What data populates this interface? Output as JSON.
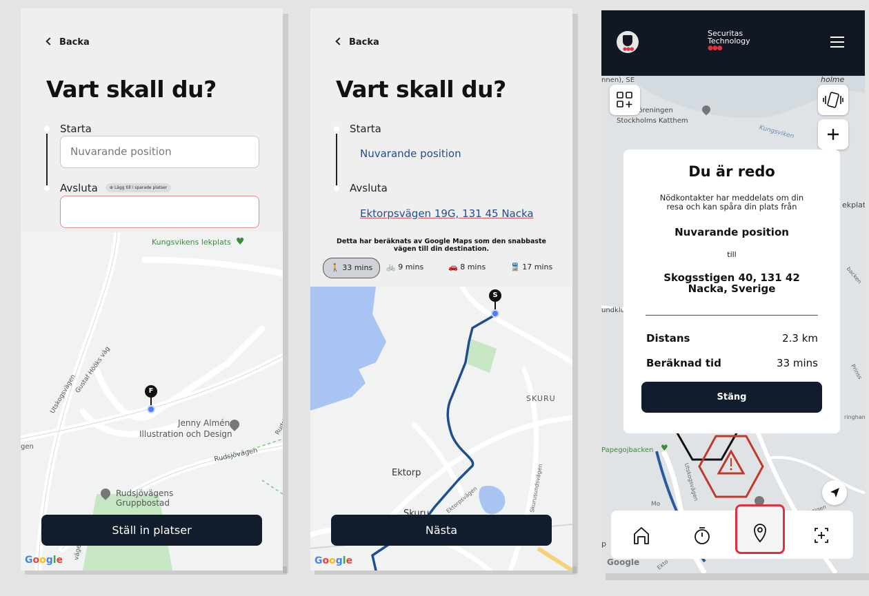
{
  "screen1": {
    "back": "Backa",
    "heading": "Vart skall du?",
    "start_label": "Starta",
    "start_placeholder": "Nuvarande position",
    "end_label": "Avsluta",
    "saved_chip": "Lägg till i sparade platser",
    "end_value": "",
    "map_labels": {
      "kungsvikens": "Kungsvikens lekplats",
      "utskogsvagen": "Utskogsvägen",
      "gustaf": "Gustaf Hööks väg",
      "jenny1": "Jenny Almén",
      "jenny2": "Illustration och Design",
      "rudsjo": "Rudsjövägen",
      "rudsjogrp1": "Rudsjövägens",
      "rudsjogrp2": "Gruppbostad",
      "gen": "gen",
      "rudsj": "Rudsj",
      "vage": "väge"
    },
    "pin_letter": "F",
    "button": "Ställ in platser",
    "google": "Google"
  },
  "screen2": {
    "back": "Backa",
    "heading": "Vart skall du?",
    "start_label": "Starta",
    "start_value": "Nuvarande position",
    "end_label": "Avsluta",
    "end_value": "Ektorpsvägen 19G, 131 45 Nacka",
    "info": "Detta har beräknats av Google Maps som den snabbaste vägen till din destination.",
    "modes": [
      {
        "icon": "walk-icon",
        "label": "33 mins",
        "selected": true
      },
      {
        "icon": "bike-icon",
        "label": "9 mins",
        "selected": false
      },
      {
        "icon": "car-icon",
        "label": "8 mins",
        "selected": false
      },
      {
        "icon": "transit-icon",
        "label": "17 mins",
        "selected": false
      }
    ],
    "map_labels": {
      "skuru": "SKURU",
      "ektorp": "Ektorp",
      "skuru2": "Skuru",
      "ektorpsvagen": "Ektorpsvägen",
      "skurusund": "Skurusundsvägen"
    },
    "pin_letter": "S",
    "button": "Nästa",
    "google": "Google"
  },
  "screen3": {
    "brand_line1": "Securitas",
    "brand_line2": "Technology",
    "map_labels": {
      "se": "nnen), SE",
      "holme": "holme",
      "foreningen1": "Föreningen",
      "foreningen2": "Stockholms Katthem",
      "kungsviken": "Kungsviken",
      "ekplat": "ekplat",
      "undklu": "undklu",
      "papegoj": "Papegojbacken",
      "solst": "Solstigen",
      "backen": "backen",
      "ringham": "ringham",
      "prinss": "Prinss",
      "utskogsv": "Utskogsvägen",
      "mo": "Mo",
      "p": "p",
      "oogle": "Google",
      "ekto": "Ekto"
    },
    "card": {
      "title": "Du är redo",
      "subtitle": "Nödkontakter har meddelats om din resa och kan spåra din plats från",
      "from": "Nuvarande position",
      "till": "till",
      "to_line1": "Skogsstigen 40, 131 42",
      "to_line2": "Nacka, Sverige",
      "distance_label": "Distans",
      "distance_value": "2.3 km",
      "time_label": "Beräknad tid",
      "time_value": "33 mins",
      "button": "Stäng"
    },
    "nav": [
      {
        "name": "home",
        "icon": "home-icon"
      },
      {
        "name": "timer",
        "icon": "timer-icon"
      },
      {
        "name": "location",
        "icon": "location-pin-icon",
        "active": true
      },
      {
        "name": "scan",
        "icon": "add-frame-icon"
      }
    ],
    "accent_red": "#e03040",
    "dark": "#111d2c"
  }
}
